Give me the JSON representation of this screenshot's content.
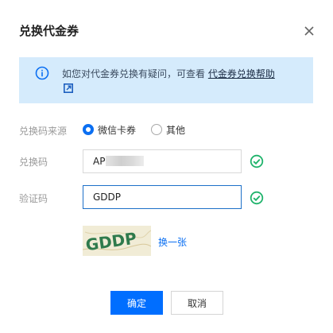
{
  "dialog": {
    "title": "兑换代金券",
    "close_icon": "close-icon"
  },
  "notice": {
    "icon": "info-icon",
    "text": "如您对代金券兑换有疑问，可查看 ",
    "link_label": "代金券兑换帮助",
    "link_icon": "external-link-icon"
  },
  "form": {
    "source_label": "兑换码来源",
    "source_options": [
      {
        "label": "微信卡券",
        "selected": true
      },
      {
        "label": "其他",
        "selected": false
      }
    ],
    "code_label": "兑换码",
    "code_value": "AP",
    "code_valid": true,
    "verify_label": "验证码",
    "verify_value": "GDDP",
    "verify_valid": true,
    "captcha_text": "GDDP",
    "refresh_label": "换一张"
  },
  "actions": {
    "confirm_label": "确定",
    "cancel_label": "取消"
  },
  "colors": {
    "accent": "#006eff",
    "notice_bg": "#d5ebfc",
    "valid": "#1fb36b"
  }
}
